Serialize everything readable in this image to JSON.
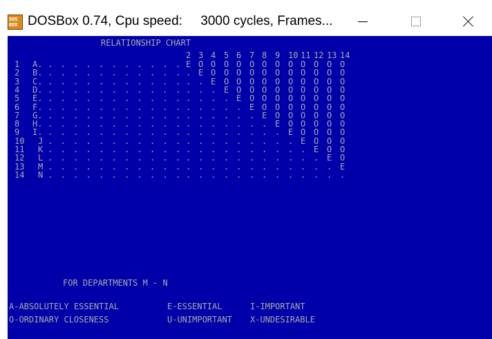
{
  "window": {
    "title": "DOSBox 0.74, Cpu speed:     3000 cycles, Frames...",
    "icon_text": "DOS BOX",
    "icon_name": "dosbox-icon",
    "controls": [
      "minimize-icon",
      "maximize-icon",
      "close-icon"
    ]
  },
  "colors": {
    "screen_background": "#0000aa",
    "screen_text": "#aaaaaa"
  },
  "chart": {
    "title": "RELATIONSHIP CHART",
    "column_headers": [
      "2",
      "3",
      "4",
      "5",
      "6",
      "7",
      "8",
      "9",
      "10",
      "11",
      "12",
      "13",
      "14"
    ],
    "rows": [
      {
        "num": "1",
        "label": "A.",
        "cells": [
          "E",
          "O",
          "O",
          "O",
          "O",
          "O",
          "O",
          "O",
          "O",
          "O",
          "O",
          "O",
          "O"
        ]
      },
      {
        "num": "2",
        "label": "B.",
        "cells": [
          ".",
          "E",
          "O",
          "O",
          "O",
          "O",
          "O",
          "O",
          "O",
          "O",
          "O",
          "O",
          "O"
        ]
      },
      {
        "num": "3",
        "label": "C.",
        "cells": [
          ".",
          ".",
          "E",
          "O",
          "O",
          "O",
          "O",
          "O",
          "O",
          "O",
          "O",
          "O",
          "O"
        ]
      },
      {
        "num": "4",
        "label": "D.",
        "cells": [
          ".",
          ".",
          ".",
          "E",
          "O",
          "O",
          "O",
          "O",
          "O",
          "O",
          "O",
          "O",
          "O"
        ]
      },
      {
        "num": "5",
        "label": "E.",
        "cells": [
          ".",
          ".",
          ".",
          ".",
          "E",
          "O",
          "O",
          "O",
          "O",
          "O",
          "O",
          "O",
          "O"
        ]
      },
      {
        "num": "6",
        "label": "F.",
        "cells": [
          ".",
          ".",
          ".",
          ".",
          ".",
          "E",
          "O",
          "O",
          "O",
          "O",
          "O",
          "O",
          "O"
        ]
      },
      {
        "num": "7",
        "label": "G.",
        "cells": [
          ".",
          ".",
          ".",
          ".",
          ".",
          ".",
          "E",
          "O",
          "O",
          "O",
          "O",
          "O",
          "O"
        ]
      },
      {
        "num": "8",
        "label": "H.",
        "cells": [
          ".",
          ".",
          ".",
          ".",
          ".",
          ".",
          ".",
          "E",
          "O",
          "O",
          "O",
          "O",
          "O"
        ]
      },
      {
        "num": "9",
        "label": "I.",
        "cells": [
          ".",
          ".",
          ".",
          ".",
          ".",
          ".",
          ".",
          ".",
          "E",
          "O",
          "O",
          "O",
          "O"
        ]
      },
      {
        "num": "10",
        "label": "J",
        "cells": [
          ".",
          ".",
          ".",
          ".",
          ".",
          ".",
          ".",
          ".",
          ".",
          "E",
          "O",
          "O",
          "O"
        ]
      },
      {
        "num": "11",
        "label": "K",
        "cells": [
          ".",
          ".",
          ".",
          ".",
          ".",
          ".",
          ".",
          ".",
          ".",
          ".",
          "E",
          "O",
          "O"
        ]
      },
      {
        "num": "12",
        "label": "L",
        "cells": [
          ".",
          ".",
          ".",
          ".",
          ".",
          ".",
          ".",
          ".",
          ".",
          ".",
          ".",
          "E",
          "O"
        ]
      },
      {
        "num": "13",
        "label": "M",
        "cells": [
          ".",
          ".",
          ".",
          ".",
          ".",
          ".",
          ".",
          ".",
          ".",
          ".",
          ".",
          ".",
          "E"
        ]
      },
      {
        "num": "14",
        "label": "N",
        "cells": [
          ".",
          ".",
          ".",
          ".",
          ".",
          ".",
          ".",
          ".",
          ".",
          ".",
          ".",
          ".",
          "."
        ]
      }
    ]
  },
  "footer": {
    "departments": "FOR DEPARTMENTS M - N",
    "legend_row1": [
      "A-ABSOLUTELY ESSENTIAL",
      "E-ESSENTIAL",
      "I-IMPORTANT"
    ],
    "legend_row2": [
      "O-ORDINARY CLOSENESS",
      "U-UNIMPORTANT",
      "X-UNDESIRABLE"
    ]
  }
}
